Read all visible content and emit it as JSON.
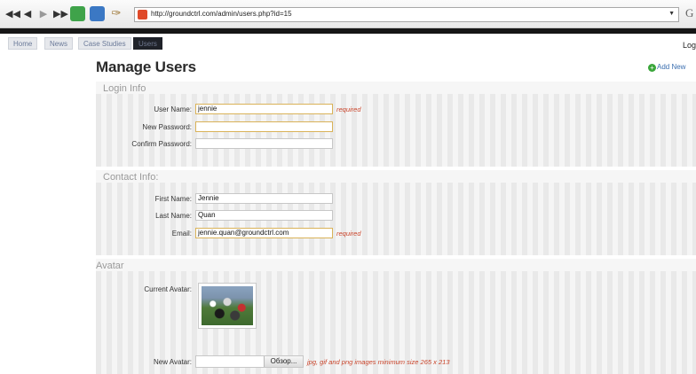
{
  "browser": {
    "address": "http://groundctrl.com/admin/users.php?id=15",
    "search_glyph": "G",
    "icons": [
      "rewind-icon",
      "back-icon",
      "forward-icon",
      "fast-forward-icon",
      "refresh-icon",
      "home-icon",
      "tools-icon"
    ]
  },
  "nav": {
    "tabs": [
      {
        "label": "Home",
        "active": false
      },
      {
        "label": "News",
        "active": false
      },
      {
        "label": "Case Studies",
        "active": false
      },
      {
        "label": "Users",
        "active": true
      }
    ],
    "logout": "Log"
  },
  "page": {
    "title": "Manage Users",
    "add_new": "Add New"
  },
  "login_info": {
    "title": "Login Info",
    "username_label": "User Name:",
    "username_value": "jennie",
    "username_required": "required",
    "new_password_label": "New Password:",
    "new_password_value": "",
    "confirm_password_label": "Confirm Password:",
    "confirm_password_value": ""
  },
  "contact_info": {
    "title": "Contact Info:",
    "first_name_label": "First Name:",
    "first_name_value": "Jennie",
    "last_name_label": "Last Name:",
    "last_name_value": "Quan",
    "email_label": "Email:",
    "email_value": "jennie.quan@groundctrl.com",
    "email_required": "required"
  },
  "avatar": {
    "title": "Avatar",
    "current_label": "Current Avatar:",
    "new_label": "New Avatar:",
    "browse_button": "Обзор...",
    "hint": "jpg, gif and png images minimum size 265 x 213"
  },
  "colors": {
    "accent_red": "#c9442a",
    "nav_active": "#1f2229",
    "add_new_green": "#3aa63a"
  }
}
